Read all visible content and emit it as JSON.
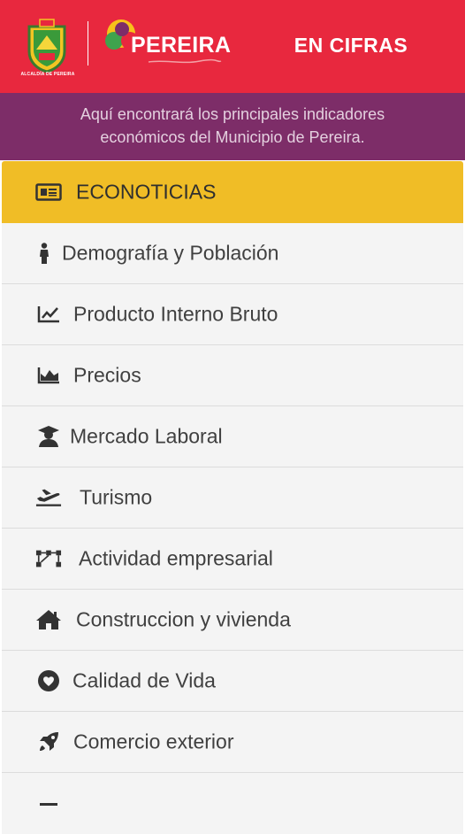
{
  "header": {
    "crest_caption": "ALCALDÍA DE PEREIRA",
    "brand_name": "PEREIRA",
    "app_title": "EN CIFRAS",
    "colors": {
      "background": "#e8283e",
      "text": "#ffffff"
    }
  },
  "subtitle": {
    "line1": "Aquí encontrará los principales indicadores",
    "line2": "económicos del Municipio de Pereira.",
    "colors": {
      "background": "#7d2d68",
      "text": "#e4d0df"
    }
  },
  "menu": {
    "active_color": "#f0bd26",
    "item_color": "#f4f4f4",
    "items": [
      {
        "label": "ECONOTICIAS",
        "icon": "newspaper-icon",
        "active": true
      },
      {
        "label": "Demografía y Población",
        "icon": "person-icon"
      },
      {
        "label": "Producto Interno Bruto",
        "icon": "line-chart-icon"
      },
      {
        "label": "Precios",
        "icon": "area-chart-icon"
      },
      {
        "label": "Mercado Laboral",
        "icon": "graduate-icon"
      },
      {
        "label": "Turismo",
        "icon": "plane-icon"
      },
      {
        "label": "Actividad empresarial",
        "icon": "network-icon"
      },
      {
        "label": "Construccion y vivienda",
        "icon": "home-icon"
      },
      {
        "label": "Calidad de Vida",
        "icon": "heart-icon"
      },
      {
        "label": "Comercio exterior",
        "icon": "rocket-icon"
      }
    ]
  }
}
